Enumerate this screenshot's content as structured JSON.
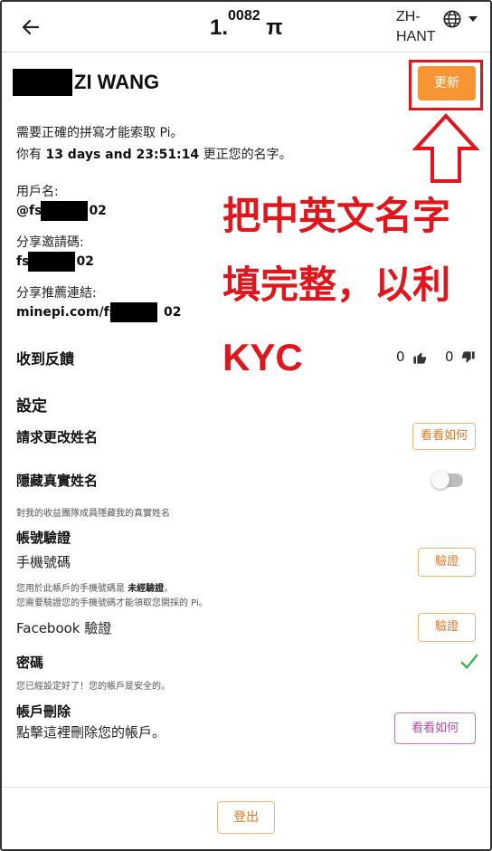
{
  "header": {
    "balance_main": "1.",
    "balance_sup": "0082",
    "balance_unit": " π",
    "lang_line1": "ZH-",
    "lang_line2": "HANT"
  },
  "profile": {
    "name_visible": "ZI WANG",
    "update_button": "更新",
    "spelling_notice": "需要正確的拼寫才能索取 Pi。",
    "time_prefix": "你有 ",
    "time_remaining": "13 days and 23:51:14",
    "time_suffix": " 更正您的名字。",
    "username_label": "用戶名:",
    "username_prefix": "@fs",
    "username_suffix": "02",
    "invite_label": "分享邀請碼:",
    "invite_prefix": "fs",
    "invite_suffix": "02",
    "referral_label": "分享推薦連結:",
    "referral_prefix": "minepi.com/fs",
    "referral_suffix": "02"
  },
  "annotation": {
    "line1": "把中英文名字",
    "line2": "填完整，以利",
    "line3": "KYC"
  },
  "feedback": {
    "label": "收到反饋",
    "likes": "0",
    "dislikes": "0"
  },
  "settings": {
    "title": "設定",
    "change_name_label": "請求更改姓名",
    "change_name_button": "看看如何",
    "hide_name_label": "隱藏真實姓名",
    "hide_name_desc": "對我的收益團隊成員隱藏我的真實姓名",
    "hide_name_enabled": false
  },
  "verification": {
    "title": "帳號驗證",
    "phone_label": "手機號碼",
    "phone_button": "驗證",
    "phone_desc_prefix": "您用於此帳戶的手機號碼是 ",
    "phone_desc_status": "未經驗證",
    "phone_desc_suffix": "。",
    "phone_desc_line2": "您需要驗證您的手機號碼才能領取您開採的 Pi。",
    "facebook_label": "Facebook 驗證",
    "facebook_button": "驗證",
    "password_label": "密碼",
    "password_desc": "您已經設定好了！您的帳戶是安全的。"
  },
  "deletion": {
    "title": "帳戶刪除",
    "desc": "點擊這裡刪除您的帳戶。",
    "button": "看看如何"
  },
  "footer": {
    "logout": "登出"
  },
  "colors": {
    "accent_orange": "#f79535",
    "annotation_red": "#e0161c",
    "check_green": "#2fb344"
  }
}
